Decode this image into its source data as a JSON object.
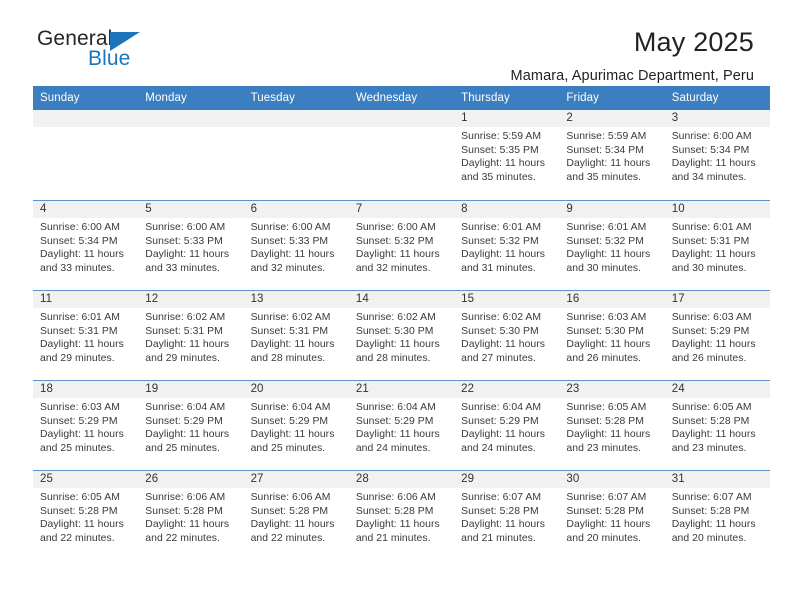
{
  "brand": {
    "name_dark": "General",
    "name_blue": "Blue",
    "triangle_color": "#1a75bb"
  },
  "header": {
    "title": "May 2025",
    "subtitle": "Mamara, Apurimac Department, Peru"
  },
  "theme": {
    "header_blue": "#3c7fc0",
    "row_border": "#5e93c9",
    "date_band": "#f1f1f1",
    "text": "#3a3a3a"
  },
  "weekdays": [
    "Sunday",
    "Monday",
    "Tuesday",
    "Wednesday",
    "Thursday",
    "Friday",
    "Saturday"
  ],
  "labels": {
    "sunrise": "Sunrise:",
    "sunset": "Sunset:",
    "daylight": "Daylight:"
  },
  "weeks": [
    [
      {
        "day": "",
        "empty": true
      },
      {
        "day": "",
        "empty": true
      },
      {
        "day": "",
        "empty": true
      },
      {
        "day": "",
        "empty": true
      },
      {
        "day": "1",
        "sunrise": "Sunrise: 5:59 AM",
        "sunset": "Sunset: 5:35 PM",
        "daylight1": "Daylight: 11 hours",
        "daylight2": "and 35 minutes."
      },
      {
        "day": "2",
        "sunrise": "Sunrise: 5:59 AM",
        "sunset": "Sunset: 5:34 PM",
        "daylight1": "Daylight: 11 hours",
        "daylight2": "and 35 minutes."
      },
      {
        "day": "3",
        "sunrise": "Sunrise: 6:00 AM",
        "sunset": "Sunset: 5:34 PM",
        "daylight1": "Daylight: 11 hours",
        "daylight2": "and 34 minutes."
      }
    ],
    [
      {
        "day": "4",
        "sunrise": "Sunrise: 6:00 AM",
        "sunset": "Sunset: 5:34 PM",
        "daylight1": "Daylight: 11 hours",
        "daylight2": "and 33 minutes."
      },
      {
        "day": "5",
        "sunrise": "Sunrise: 6:00 AM",
        "sunset": "Sunset: 5:33 PM",
        "daylight1": "Daylight: 11 hours",
        "daylight2": "and 33 minutes."
      },
      {
        "day": "6",
        "sunrise": "Sunrise: 6:00 AM",
        "sunset": "Sunset: 5:33 PM",
        "daylight1": "Daylight: 11 hours",
        "daylight2": "and 32 minutes."
      },
      {
        "day": "7",
        "sunrise": "Sunrise: 6:00 AM",
        "sunset": "Sunset: 5:32 PM",
        "daylight1": "Daylight: 11 hours",
        "daylight2": "and 32 minutes."
      },
      {
        "day": "8",
        "sunrise": "Sunrise: 6:01 AM",
        "sunset": "Sunset: 5:32 PM",
        "daylight1": "Daylight: 11 hours",
        "daylight2": "and 31 minutes."
      },
      {
        "day": "9",
        "sunrise": "Sunrise: 6:01 AM",
        "sunset": "Sunset: 5:32 PM",
        "daylight1": "Daylight: 11 hours",
        "daylight2": "and 30 minutes."
      },
      {
        "day": "10",
        "sunrise": "Sunrise: 6:01 AM",
        "sunset": "Sunset: 5:31 PM",
        "daylight1": "Daylight: 11 hours",
        "daylight2": "and 30 minutes."
      }
    ],
    [
      {
        "day": "11",
        "sunrise": "Sunrise: 6:01 AM",
        "sunset": "Sunset: 5:31 PM",
        "daylight1": "Daylight: 11 hours",
        "daylight2": "and 29 minutes."
      },
      {
        "day": "12",
        "sunrise": "Sunrise: 6:02 AM",
        "sunset": "Sunset: 5:31 PM",
        "daylight1": "Daylight: 11 hours",
        "daylight2": "and 29 minutes."
      },
      {
        "day": "13",
        "sunrise": "Sunrise: 6:02 AM",
        "sunset": "Sunset: 5:31 PM",
        "daylight1": "Daylight: 11 hours",
        "daylight2": "and 28 minutes."
      },
      {
        "day": "14",
        "sunrise": "Sunrise: 6:02 AM",
        "sunset": "Sunset: 5:30 PM",
        "daylight1": "Daylight: 11 hours",
        "daylight2": "and 28 minutes."
      },
      {
        "day": "15",
        "sunrise": "Sunrise: 6:02 AM",
        "sunset": "Sunset: 5:30 PM",
        "daylight1": "Daylight: 11 hours",
        "daylight2": "and 27 minutes."
      },
      {
        "day": "16",
        "sunrise": "Sunrise: 6:03 AM",
        "sunset": "Sunset: 5:30 PM",
        "daylight1": "Daylight: 11 hours",
        "daylight2": "and 26 minutes."
      },
      {
        "day": "17",
        "sunrise": "Sunrise: 6:03 AM",
        "sunset": "Sunset: 5:29 PM",
        "daylight1": "Daylight: 11 hours",
        "daylight2": "and 26 minutes."
      }
    ],
    [
      {
        "day": "18",
        "sunrise": "Sunrise: 6:03 AM",
        "sunset": "Sunset: 5:29 PM",
        "daylight1": "Daylight: 11 hours",
        "daylight2": "and 25 minutes."
      },
      {
        "day": "19",
        "sunrise": "Sunrise: 6:04 AM",
        "sunset": "Sunset: 5:29 PM",
        "daylight1": "Daylight: 11 hours",
        "daylight2": "and 25 minutes."
      },
      {
        "day": "20",
        "sunrise": "Sunrise: 6:04 AM",
        "sunset": "Sunset: 5:29 PM",
        "daylight1": "Daylight: 11 hours",
        "daylight2": "and 25 minutes."
      },
      {
        "day": "21",
        "sunrise": "Sunrise: 6:04 AM",
        "sunset": "Sunset: 5:29 PM",
        "daylight1": "Daylight: 11 hours",
        "daylight2": "and 24 minutes."
      },
      {
        "day": "22",
        "sunrise": "Sunrise: 6:04 AM",
        "sunset": "Sunset: 5:29 PM",
        "daylight1": "Daylight: 11 hours",
        "daylight2": "and 24 minutes."
      },
      {
        "day": "23",
        "sunrise": "Sunrise: 6:05 AM",
        "sunset": "Sunset: 5:28 PM",
        "daylight1": "Daylight: 11 hours",
        "daylight2": "and 23 minutes."
      },
      {
        "day": "24",
        "sunrise": "Sunrise: 6:05 AM",
        "sunset": "Sunset: 5:28 PM",
        "daylight1": "Daylight: 11 hours",
        "daylight2": "and 23 minutes."
      }
    ],
    [
      {
        "day": "25",
        "sunrise": "Sunrise: 6:05 AM",
        "sunset": "Sunset: 5:28 PM",
        "daylight1": "Daylight: 11 hours",
        "daylight2": "and 22 minutes."
      },
      {
        "day": "26",
        "sunrise": "Sunrise: 6:06 AM",
        "sunset": "Sunset: 5:28 PM",
        "daylight1": "Daylight: 11 hours",
        "daylight2": "and 22 minutes."
      },
      {
        "day": "27",
        "sunrise": "Sunrise: 6:06 AM",
        "sunset": "Sunset: 5:28 PM",
        "daylight1": "Daylight: 11 hours",
        "daylight2": "and 22 minutes."
      },
      {
        "day": "28",
        "sunrise": "Sunrise: 6:06 AM",
        "sunset": "Sunset: 5:28 PM",
        "daylight1": "Daylight: 11 hours",
        "daylight2": "and 21 minutes."
      },
      {
        "day": "29",
        "sunrise": "Sunrise: 6:07 AM",
        "sunset": "Sunset: 5:28 PM",
        "daylight1": "Daylight: 11 hours",
        "daylight2": "and 21 minutes."
      },
      {
        "day": "30",
        "sunrise": "Sunrise: 6:07 AM",
        "sunset": "Sunset: 5:28 PM",
        "daylight1": "Daylight: 11 hours",
        "daylight2": "and 20 minutes."
      },
      {
        "day": "31",
        "sunrise": "Sunrise: 6:07 AM",
        "sunset": "Sunset: 5:28 PM",
        "daylight1": "Daylight: 11 hours",
        "daylight2": "and 20 minutes."
      }
    ]
  ]
}
